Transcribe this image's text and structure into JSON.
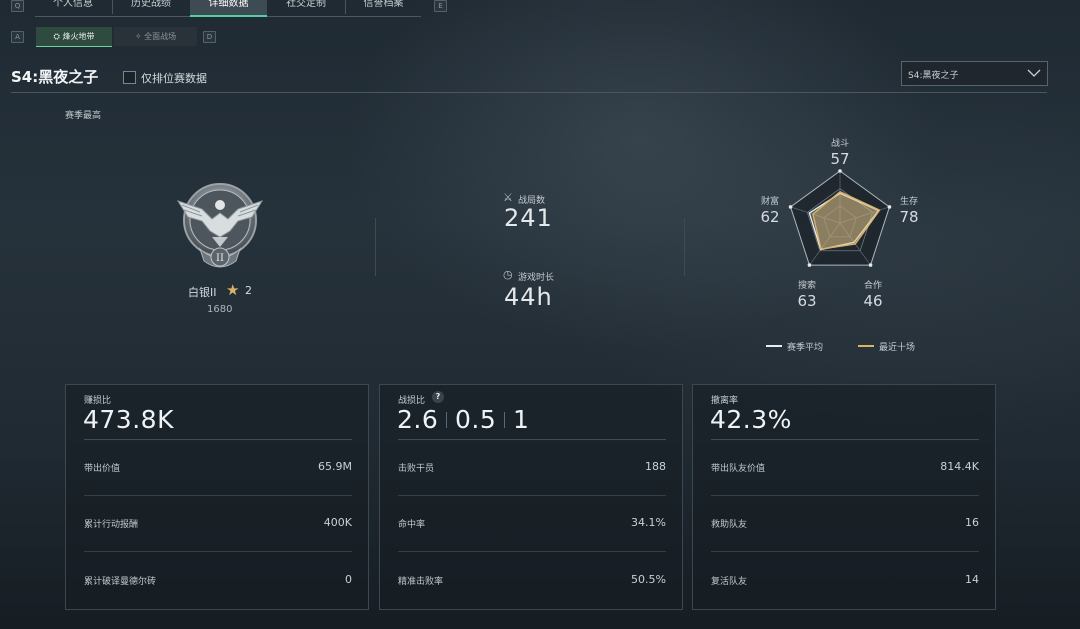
{
  "top_nav": {
    "left_key": "Q",
    "right_key": "E",
    "tabs": [
      {
        "label": "个人信息"
      },
      {
        "label": "历史战绩"
      },
      {
        "label": "详细数据"
      },
      {
        "label": "社交定制"
      },
      {
        "label": "信誉档案"
      }
    ],
    "active_tab": "详细数据"
  },
  "sub_nav": {
    "left_key": "A",
    "right_key": "D",
    "tabs": [
      {
        "label": "烽火地带",
        "icon": "zone-icon"
      },
      {
        "label": "全面战场",
        "icon": "battlefield-icon"
      }
    ],
    "active_tab": "烽火地带"
  },
  "header": {
    "season_title": "S4:黑夜之子",
    "ranked_only_label": "仅排位赛数据",
    "ranked_only_checked": false,
    "season_select_value": "S4:黑夜之子"
  },
  "summary": {
    "section_label": "赛季最高",
    "rank": {
      "name": "白银II",
      "stars": "2",
      "score": "1680",
      "tier_numeral": "II"
    },
    "matches": {
      "label": "战局数",
      "value": "241",
      "icon": "crossed-swords-icon"
    },
    "playtime": {
      "label": "游戏时长",
      "value": "44h",
      "icon": "clock-icon"
    }
  },
  "radar": {
    "axes": [
      {
        "label": "战斗",
        "value": "57"
      },
      {
        "label": "生存",
        "value": "78"
      },
      {
        "label": "合作",
        "value": "46"
      },
      {
        "label": "搜索",
        "value": "63"
      },
      {
        "label": "财富",
        "value": "62"
      }
    ],
    "series": [
      {
        "name": "赛季平均",
        "color": "#e8ecef",
        "values": [
          57,
          78,
          46,
          63,
          62
        ]
      },
      {
        "name": "最近十场",
        "color": "#d9b36a",
        "values": [
          60,
          80,
          50,
          62,
          55
        ]
      }
    ],
    "max": 100
  },
  "cards": [
    {
      "title": "赚损比",
      "big": "473.8K",
      "rows": [
        {
          "label": "带出价值",
          "value": "65.9M"
        },
        {
          "label": "累计行动报酬",
          "value": "400K"
        },
        {
          "label": "累计破译曼德尔砖",
          "value": "0"
        }
      ]
    },
    {
      "title": "战损比",
      "big_parts": [
        "2.6",
        "0.5",
        "1"
      ],
      "help": "?",
      "rows": [
        {
          "label": "击败干员",
          "value": "188"
        },
        {
          "label": "命中率",
          "value": "34.1%"
        },
        {
          "label": "精准击败率",
          "value": "50.5%"
        }
      ]
    },
    {
      "title": "撤离率",
      "big": "42.3%",
      "rows": [
        {
          "label": "带出队友价值",
          "value": "814.4K"
        },
        {
          "label": "救助队友",
          "value": "16"
        },
        {
          "label": "复活队友",
          "value": "14"
        }
      ]
    }
  ],
  "colors": {
    "accent_green": "#4fd0a0",
    "gold": "#d9b36a",
    "text": "#d7dde2"
  }
}
